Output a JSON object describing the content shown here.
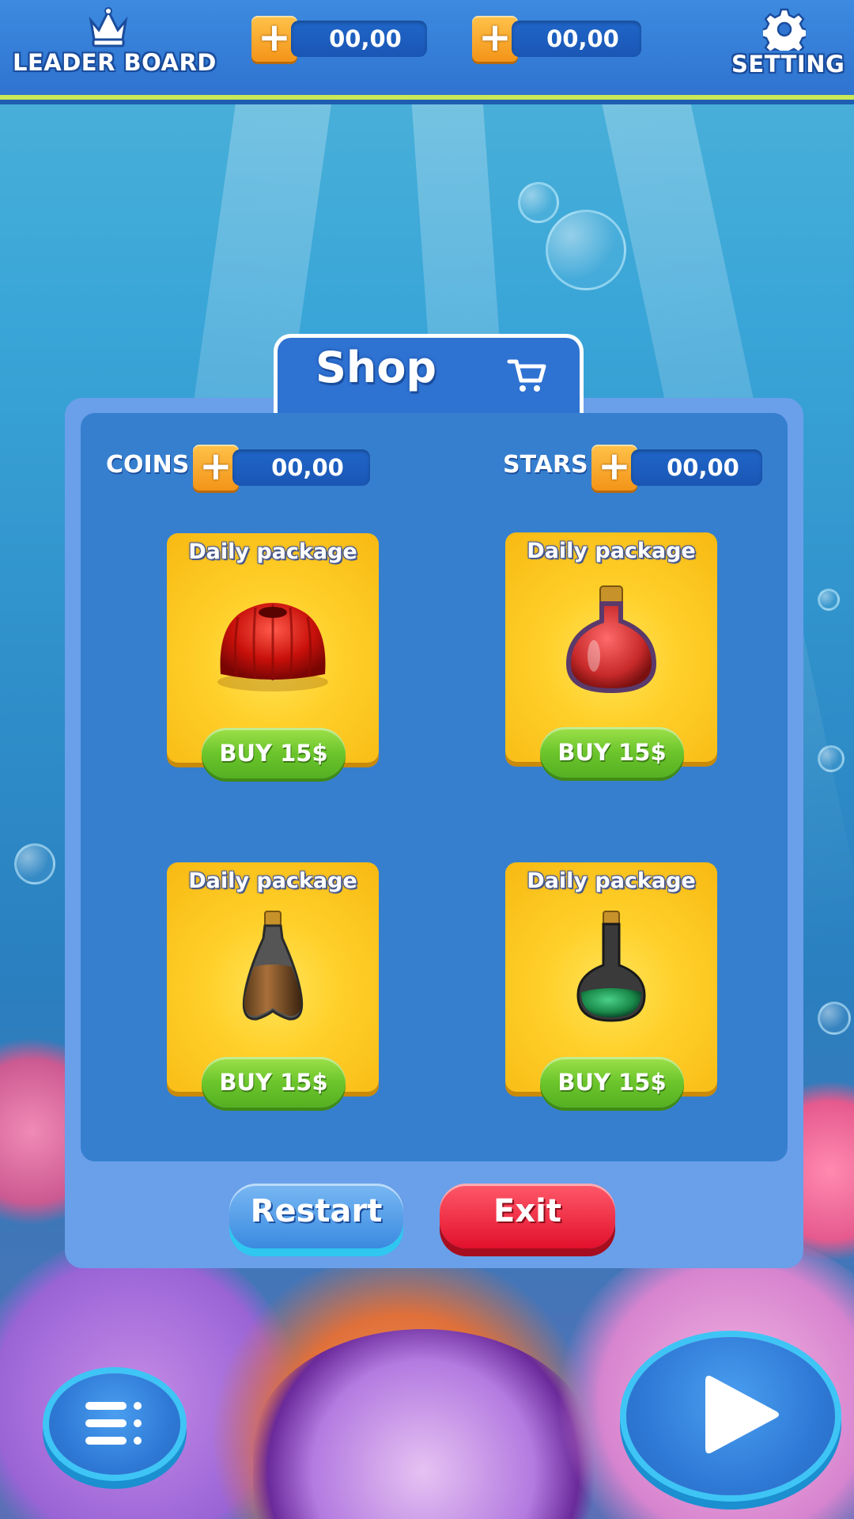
{
  "topbar": {
    "leaderboard_label": "LEADER BOARD",
    "counter1_value": "00,00",
    "counter2_value": "00,00",
    "setting_label": "SETTING"
  },
  "shop": {
    "title": "Shop",
    "coins_label": "COINS",
    "coins_value": "00,00",
    "stars_label": "STARS",
    "stars_value": "00,00",
    "packages": [
      {
        "title": "Daily package",
        "item": "jelly-icon",
        "buy_label": "BUY 15$"
      },
      {
        "title": "Daily package",
        "item": "red-potion-icon",
        "buy_label": "BUY 15$"
      },
      {
        "title": "Daily package",
        "item": "brown-potion-icon",
        "buy_label": "BUY 15$"
      },
      {
        "title": "Daily package",
        "item": "green-potion-icon",
        "buy_label": "BUY 15$"
      }
    ],
    "restart_label": "Restart",
    "exit_label": "Exit"
  },
  "colors": {
    "accent_orange": "#f39418",
    "buy_green": "#6cc52c",
    "exit_red": "#e2102c",
    "panel_blue": "#367fcf"
  }
}
